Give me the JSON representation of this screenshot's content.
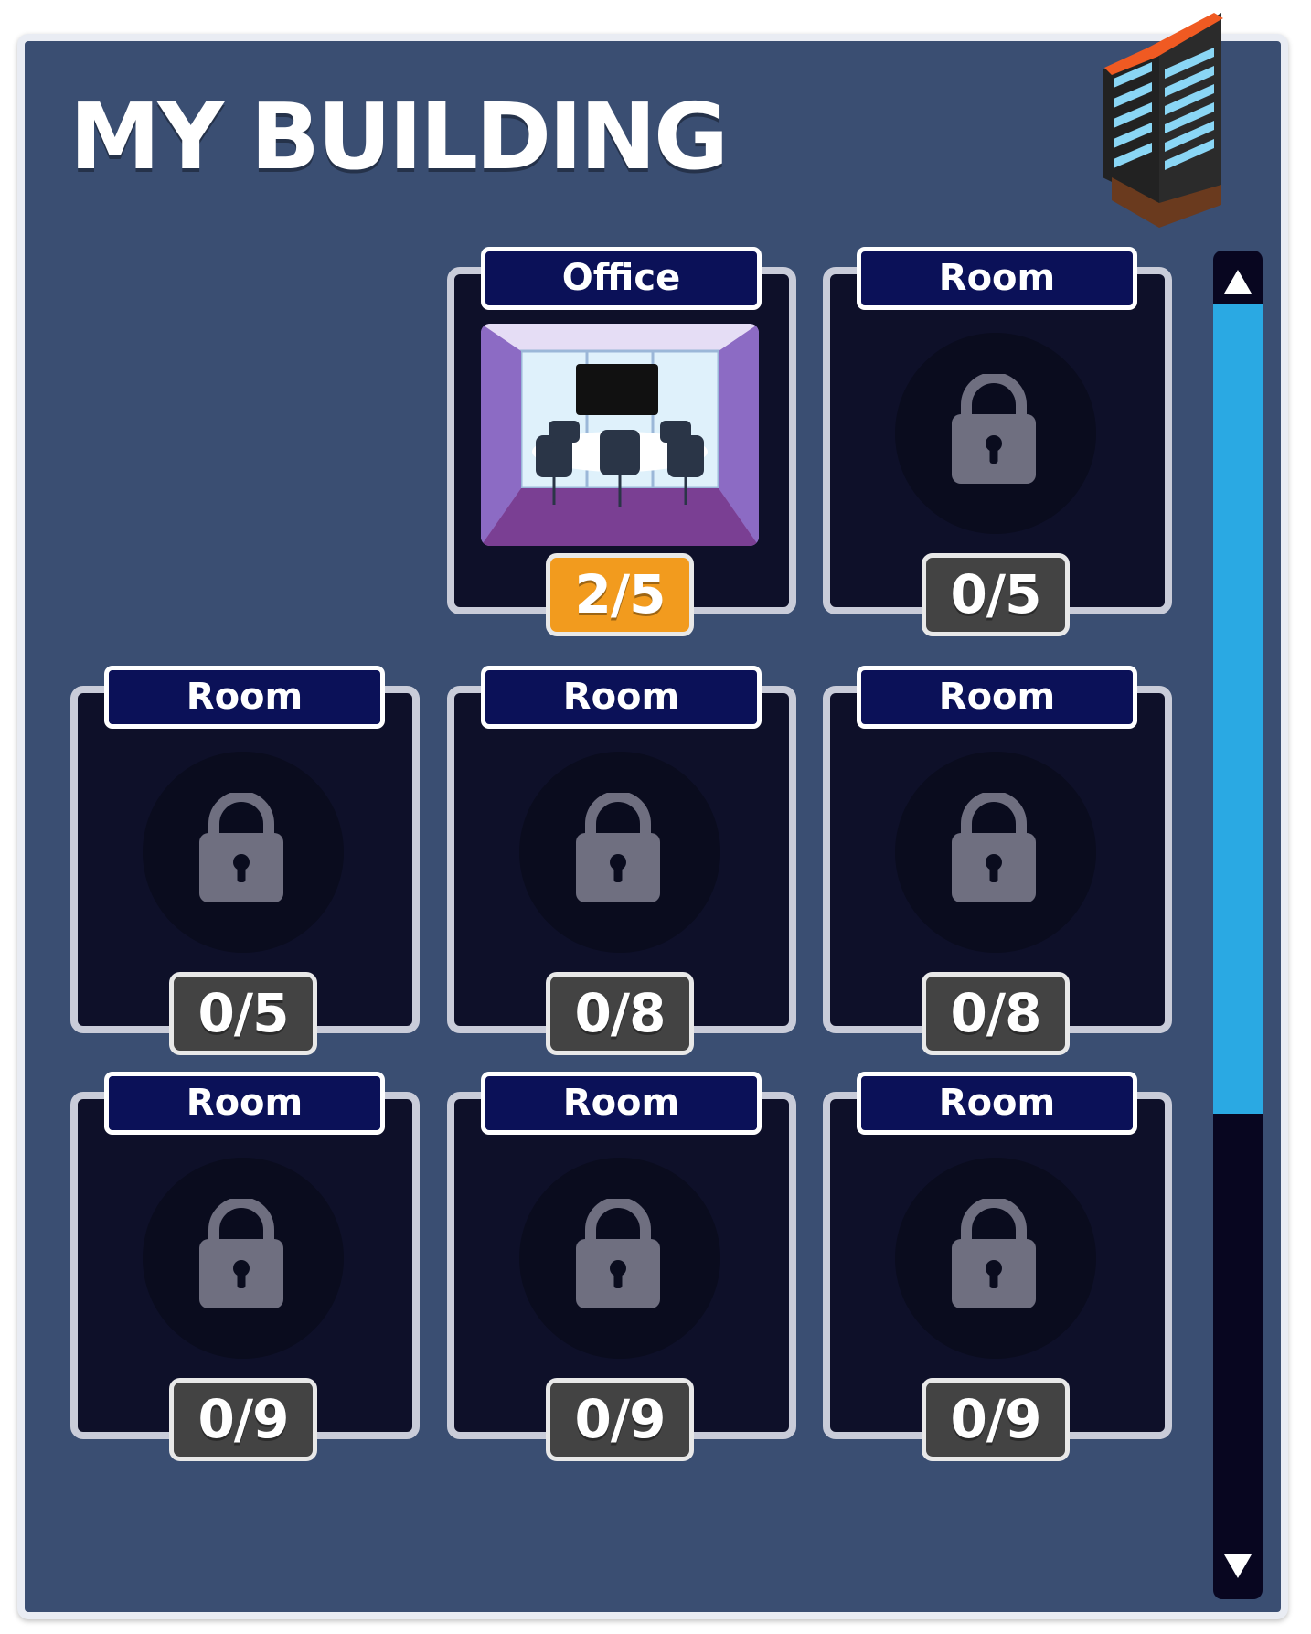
{
  "title": "MY BUILDING",
  "icons": {
    "building": "building-icon",
    "lock": "lock-icon",
    "scroll_up": "triangle-up-icon",
    "scroll_down": "triangle-down-icon"
  },
  "colors": {
    "panel_bg": "#3a4e72",
    "card_bg": "#0e1029",
    "label_bg": "#0b1158",
    "badge_default": "#434343",
    "badge_active": "#f29b1e",
    "scroll_thumb": "#2aa9e3"
  },
  "rooms": [
    {
      "label": "Office",
      "count": "2/5",
      "unlocked": true
    },
    {
      "label": "Room",
      "count": "0/5",
      "unlocked": false
    },
    {
      "label": "Room",
      "count": "0/5",
      "unlocked": false
    },
    {
      "label": "Room",
      "count": "0/8",
      "unlocked": false
    },
    {
      "label": "Room",
      "count": "0/8",
      "unlocked": false
    },
    {
      "label": "Room",
      "count": "0/9",
      "unlocked": false
    },
    {
      "label": "Room",
      "count": "0/9",
      "unlocked": false
    },
    {
      "label": "Room",
      "count": "0/9",
      "unlocked": false
    }
  ],
  "scrollbar": {
    "thumb_start_fraction": 0.04,
    "thumb_end_fraction": 0.64
  }
}
